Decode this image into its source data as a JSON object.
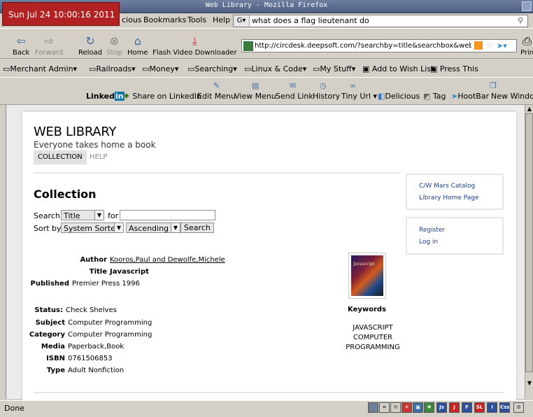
{
  "window": {
    "title": "Web Library - Mozilla Firefox"
  },
  "clock": "Sun Jul 24 10:00:16 2011",
  "menubar": {
    "items": [
      "cious",
      "Bookmarks",
      "Tools",
      "Help"
    ]
  },
  "search_bar": {
    "value": "what does a flag lieutenant do"
  },
  "nav": {
    "back": "Back",
    "forward": "Forward",
    "reload": "Reload",
    "stop": "Stop",
    "home": "Home",
    "flash": "Flash Video Downloader",
    "print": "Prin"
  },
  "urlbar": {
    "value": "http://circdesk.deepsoft.com/?searchby=title&searchbox&weblil"
  },
  "bookmarks": [
    "Merchant Admin",
    "Railroads",
    "Money",
    "Searching",
    "Linux & Code",
    "My Stuff",
    "Add to Wish List",
    "Press This"
  ],
  "addons": {
    "linkedin": "Linked",
    "linkedin_in": "in",
    "items": [
      "Share on LinkedIn",
      "Edit Menu",
      "View Menu",
      "Send Link",
      "History",
      "Tiny Url",
      "Delicious",
      "Tag",
      "HootBar",
      "New Window"
    ]
  },
  "page": {
    "title": "WEB LIBRARY",
    "subtitle": "Everyone takes home a book",
    "tabs": {
      "collection": "COLLECTION",
      "help": "HELP"
    },
    "heading": "Collection",
    "search_label": "Search:",
    "search_by": "Title",
    "for_label": "for",
    "search_value": "",
    "sort_label": "Sort by:",
    "sort_field": "System Sorted",
    "sort_order": "Ascending",
    "search_button": "Search",
    "side_links": {
      "catalog": "C/W Mars Catalog",
      "home": "Library Home Page",
      "register": "Register",
      "login": "Log in"
    },
    "record": {
      "author_label": "Author",
      "author": "Kooros,Paul and Dewolfe,Michele",
      "title_label": "Title",
      "title": "Javascript",
      "published_label": "Published",
      "published": "Premier Press 1996",
      "status_label": "Status:",
      "status": "Check Shelves",
      "subject_label": "Subject",
      "subject": "Computer Programming",
      "category_label": "Category",
      "category": "Computer Programming",
      "media_label": "Media",
      "media": "Paperback,Book",
      "isbn_label": "ISBN",
      "isbn": "0761506853",
      "type_label": "Type",
      "type": "Adult Nonfiction"
    },
    "keywords_label": "Keywords",
    "keywords": [
      "JAVASCRIPT",
      "COMPUTER",
      "PROGRAMMING"
    ]
  },
  "status": {
    "text": "Done"
  },
  "status_icons": [
    "Js",
    "J",
    "F",
    "SL",
    "I",
    "Css"
  ]
}
